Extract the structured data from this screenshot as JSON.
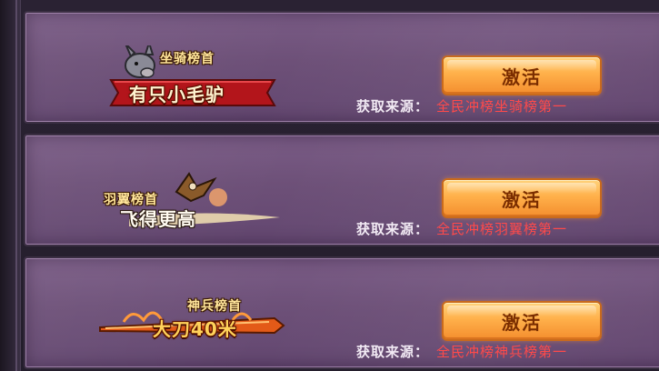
{
  "cards": [
    {
      "badge_title": "坐骑榜首",
      "badge_main": "有只小毛驴",
      "badge_icon": "donkey-icon",
      "button_label": "激活",
      "source_label": "获取来源：",
      "source_value": "全民冲榜坐骑榜第一"
    },
    {
      "badge_title": "羽翼榜首",
      "badge_main": "飞得更高",
      "badge_icon": "eagle-icon",
      "button_label": "激活",
      "source_label": "获取来源：",
      "source_value": "全民冲榜羽翼榜第一"
    },
    {
      "badge_title": "神兵榜首",
      "badge_main": "大刀40米",
      "badge_icon": "blade-icon",
      "button_label": "激活",
      "source_label": "获取来源：",
      "source_value": "全民冲榜神兵榜第一"
    }
  ],
  "colors": {
    "card_bg": "#6d5078",
    "button": "#ffb04a",
    "source_value": "#ff4a4a"
  }
}
